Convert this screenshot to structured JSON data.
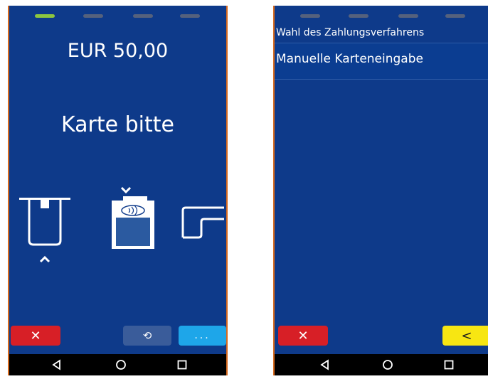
{
  "payment_screen": {
    "amount": "EUR 50,00",
    "prompt": "Karte bitte",
    "progress_step": 1,
    "progress_total": 4,
    "buttons": {
      "cancel_symbol": "✕",
      "refresh_symbol": "⟲",
      "more_symbol": "..."
    },
    "icons": [
      "insert-card-icon",
      "contactless-tap-icon",
      "swipe-card-icon"
    ]
  },
  "method_screen": {
    "title": "Wahl des Zahlungsverfahrens",
    "options": [
      {
        "label": "Manuelle Karteneingabe"
      }
    ],
    "buttons": {
      "cancel_symbol": "✕",
      "back_symbol": "<"
    }
  },
  "navbar": {
    "icons": [
      "back-triangle-icon",
      "home-circle-icon",
      "recents-square-icon"
    ]
  },
  "colors": {
    "background": "#0e3a8a",
    "progress_active": "#8dc63f",
    "progress_inactive": "#55617d",
    "cancel": "#d71f26",
    "more": "#1ea6e9",
    "back": "#f7e612",
    "frame": "#d76a1e"
  }
}
